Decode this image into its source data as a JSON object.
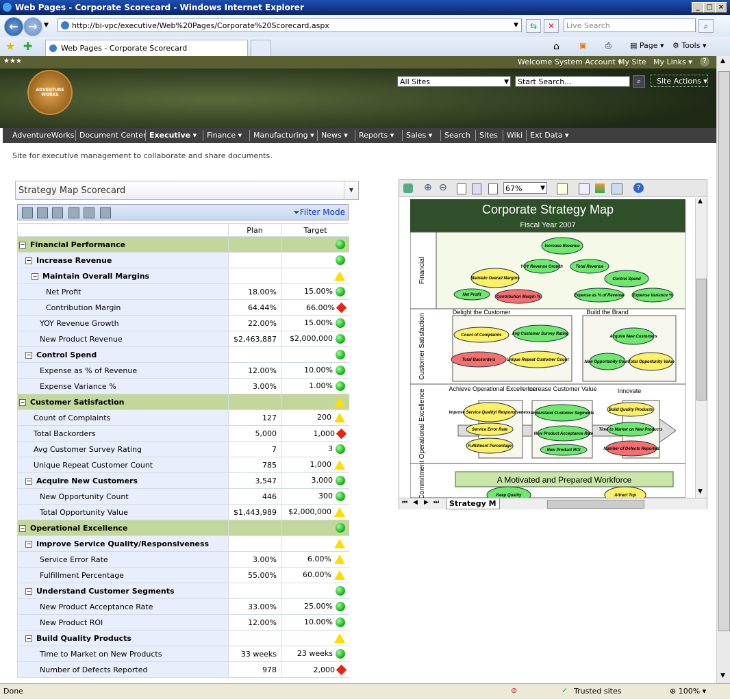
{
  "browser": {
    "window_title": "Web Pages - Corporate Scorecard - Windows Internet Explorer",
    "url": "http://bi-vpc/executive/Web%20Pages/Corporate%20Scorecard.aspx",
    "search_placeholder": "Live Search",
    "tab_title": "Web Pages - Corporate Scorecard",
    "page_menu": "Page",
    "tools_menu": "Tools",
    "status_left": "Done",
    "zone": "Trusted sites",
    "zoom": "100%"
  },
  "sharepoint": {
    "top_links": [
      "Welcome System Account",
      "My Site",
      "My Links"
    ],
    "logo_text": "ADVENTURE WORKS",
    "scope": "All Sites",
    "search_placeholder": "Start Search...",
    "site_actions": "Site Actions",
    "nav": [
      {
        "label": "AdventureWorks",
        "dropdown": false
      },
      {
        "label": "Document Center",
        "dropdown": false
      },
      {
        "label": "Executive",
        "dropdown": true,
        "selected": true
      },
      {
        "label": "Finance",
        "dropdown": true
      },
      {
        "label": "Manufacturing",
        "dropdown": true
      },
      {
        "label": "News",
        "dropdown": true
      },
      {
        "label": "Reports",
        "dropdown": true
      },
      {
        "label": "Sales",
        "dropdown": true
      },
      {
        "label": "Search",
        "dropdown": false
      },
      {
        "label": "Sites",
        "dropdown": false
      },
      {
        "label": "Wiki",
        "dropdown": false
      },
      {
        "label": "Ext Data",
        "dropdown": true
      }
    ],
    "site_description": "Site for executive management to collaborate and share documents."
  },
  "scorecard": {
    "title": "Strategy Map Scorecard",
    "filter_mode": "Filter Mode",
    "columns": [
      "Plan",
      "Target"
    ],
    "rows": [
      {
        "level": 0,
        "type": "category",
        "label": "Financial Performance",
        "plan": "",
        "target": "",
        "status": "green"
      },
      {
        "level": 1,
        "type": "objective",
        "label": "Increase Revenue",
        "plan": "",
        "target": "",
        "status": "green"
      },
      {
        "level": 2,
        "type": "objective",
        "label": "Maintain Overall Margins",
        "plan": "",
        "target": "",
        "status": "yellow"
      },
      {
        "level": 3,
        "type": "kpi",
        "label": "Net Profit",
        "plan": "18.00%",
        "target": "15.00%",
        "status": "green"
      },
      {
        "level": 3,
        "type": "kpi",
        "label": "Contribution Margin",
        "plan": "64.44%",
        "target": "66.00%",
        "status": "red"
      },
      {
        "level": 2,
        "type": "kpi",
        "label": "YOY Revenue Growth",
        "plan": "22.00%",
        "target": "15.00%",
        "status": "green"
      },
      {
        "level": 2,
        "type": "kpi",
        "label": "New Product Revenue",
        "plan": "$2,463,887",
        "target": "$2,000,000",
        "status": "green"
      },
      {
        "level": 1,
        "type": "objective",
        "label": "Control Spend",
        "plan": "",
        "target": "",
        "status": "green"
      },
      {
        "level": 2,
        "type": "kpi",
        "label": "Expense as % of Revenue",
        "plan": "12.00%",
        "target": "10.00%",
        "status": "green"
      },
      {
        "level": 2,
        "type": "kpi",
        "label": "Expense Variance %",
        "plan": "3.00%",
        "target": "1.00%",
        "status": "green"
      },
      {
        "level": 0,
        "type": "category",
        "label": "Customer Satisfaction",
        "plan": "",
        "target": "",
        "status": "yellow"
      },
      {
        "level": 1,
        "type": "kpi",
        "label": "Count of Complaints",
        "plan": "127",
        "target": "200",
        "status": "yellow"
      },
      {
        "level": 1,
        "type": "kpi",
        "label": "Total Backorders",
        "plan": "5,000",
        "target": "1,000",
        "status": "red"
      },
      {
        "level": 1,
        "type": "kpi",
        "label": "Avg Customer Survey Rating",
        "plan": "7",
        "target": "3",
        "status": "green"
      },
      {
        "level": 1,
        "type": "kpi",
        "label": "Unique Repeat Customer Count",
        "plan": "785",
        "target": "1,000",
        "status": "yellow"
      },
      {
        "level": 1,
        "type": "objective",
        "label": "Acquire New Customers",
        "plan": "3,547",
        "target": "3,000",
        "status": "green"
      },
      {
        "level": 2,
        "type": "kpi",
        "label": "New Opportunity Count",
        "plan": "446",
        "target": "300",
        "status": "green"
      },
      {
        "level": 2,
        "type": "kpi",
        "label": "Total Opportunity Value",
        "plan": "$1,443,989",
        "target": "$2,000,000",
        "status": "yellow"
      },
      {
        "level": 0,
        "type": "category",
        "label": "Operational Excellence",
        "plan": "",
        "target": "",
        "status": "green"
      },
      {
        "level": 1,
        "type": "objective",
        "label": "Improve Service Quality/Responsiveness",
        "plan": "",
        "target": "",
        "status": "yellow"
      },
      {
        "level": 2,
        "type": "kpi",
        "label": "Service Error Rate",
        "plan": "3.00%",
        "target": "6.00%",
        "status": "yellow"
      },
      {
        "level": 2,
        "type": "kpi",
        "label": "Fulfillment Percentage",
        "plan": "55.00%",
        "target": "60.00%",
        "status": "yellow"
      },
      {
        "level": 1,
        "type": "objective",
        "label": "Understand Customer Segments",
        "plan": "",
        "target": "",
        "status": "green"
      },
      {
        "level": 2,
        "type": "kpi",
        "label": "New Product Acceptance Rate",
        "plan": "33.00%",
        "target": "25.00%",
        "status": "green"
      },
      {
        "level": 2,
        "type": "kpi",
        "label": "New Product ROI",
        "plan": "12.00%",
        "target": "10.00%",
        "status": "green"
      },
      {
        "level": 1,
        "type": "objective",
        "label": "Build Quality Products",
        "plan": "",
        "target": "",
        "status": "yellow"
      },
      {
        "level": 2,
        "type": "kpi",
        "label": "Time to Market on New Products",
        "plan": "33 weeks",
        "target": "23 weeks",
        "status": "green"
      },
      {
        "level": 2,
        "type": "kpi",
        "label": "Number of Defects Reported",
        "plan": "978",
        "target": "2,000",
        "status": "red"
      }
    ]
  },
  "strategy_map": {
    "title": "Corporate Strategy Map",
    "subtitle": "Fiscal Year 2007",
    "zoom": "67%",
    "sheet_tab": "Strategy M",
    "perspectives": [
      "Financial",
      "Customer Satisfaction",
      "Operational Excellence",
      "Commitment"
    ],
    "groups": [
      "Delight the Customer",
      "Build the Brand",
      "Achieve Operational Excellence",
      "Increase Customer Value",
      "Innovate"
    ],
    "banner": "A Motivated and Prepared Workforce",
    "nodes": [
      {
        "label": "Increase Revenue",
        "color": "green"
      },
      {
        "label": "YOY Revenue Growth",
        "color": "green"
      },
      {
        "label": "Total Revenue",
        "color": "green"
      },
      {
        "label": "Maintain Overall Margins",
        "color": "yellow"
      },
      {
        "label": "Control Spend",
        "color": "green"
      },
      {
        "label": "Net Profit",
        "color": "green"
      },
      {
        "label": "Contribution Margin %",
        "color": "red"
      },
      {
        "label": "Expense as % of Revenue",
        "color": "green"
      },
      {
        "label": "Expense Variance %",
        "color": "green"
      },
      {
        "label": "Count of Complaints",
        "color": "yellow"
      },
      {
        "label": "Avg Customer Survey Rating",
        "color": "green"
      },
      {
        "label": "Total Backorders",
        "color": "red"
      },
      {
        "label": "Unique Repeat Customer Count",
        "color": "yellow"
      },
      {
        "label": "Acquire New Customers",
        "color": "green"
      },
      {
        "label": "New Opportunity Count",
        "color": "green"
      },
      {
        "label": "Total Opportunity Value",
        "color": "yellow"
      },
      {
        "label": "Improve Service Quality/ Responsiveness",
        "color": "yellow"
      },
      {
        "label": "Service Error Rate",
        "color": "yellow"
      },
      {
        "label": "Fulfillment Percentage",
        "color": "yellow"
      },
      {
        "label": "Understand Customer Segments",
        "color": "green"
      },
      {
        "label": "New Product Acceptance Rate",
        "color": "green"
      },
      {
        "label": "New Product ROI",
        "color": "green"
      },
      {
        "label": "Build Quality Products",
        "color": "yellow"
      },
      {
        "label": "Time to Market on New Products",
        "color": "green"
      },
      {
        "label": "Number of Defects Reported",
        "color": "red"
      },
      {
        "label": "Keep Quality",
        "color": "green"
      },
      {
        "label": "Attract Top",
        "color": "yellow"
      }
    ]
  },
  "colors": {
    "green": "#22cc22",
    "yellow": "#ffdd00",
    "red": "#ee2211",
    "category_bg": "#c3d69b",
    "nav_bg": "#3f3f3f"
  }
}
